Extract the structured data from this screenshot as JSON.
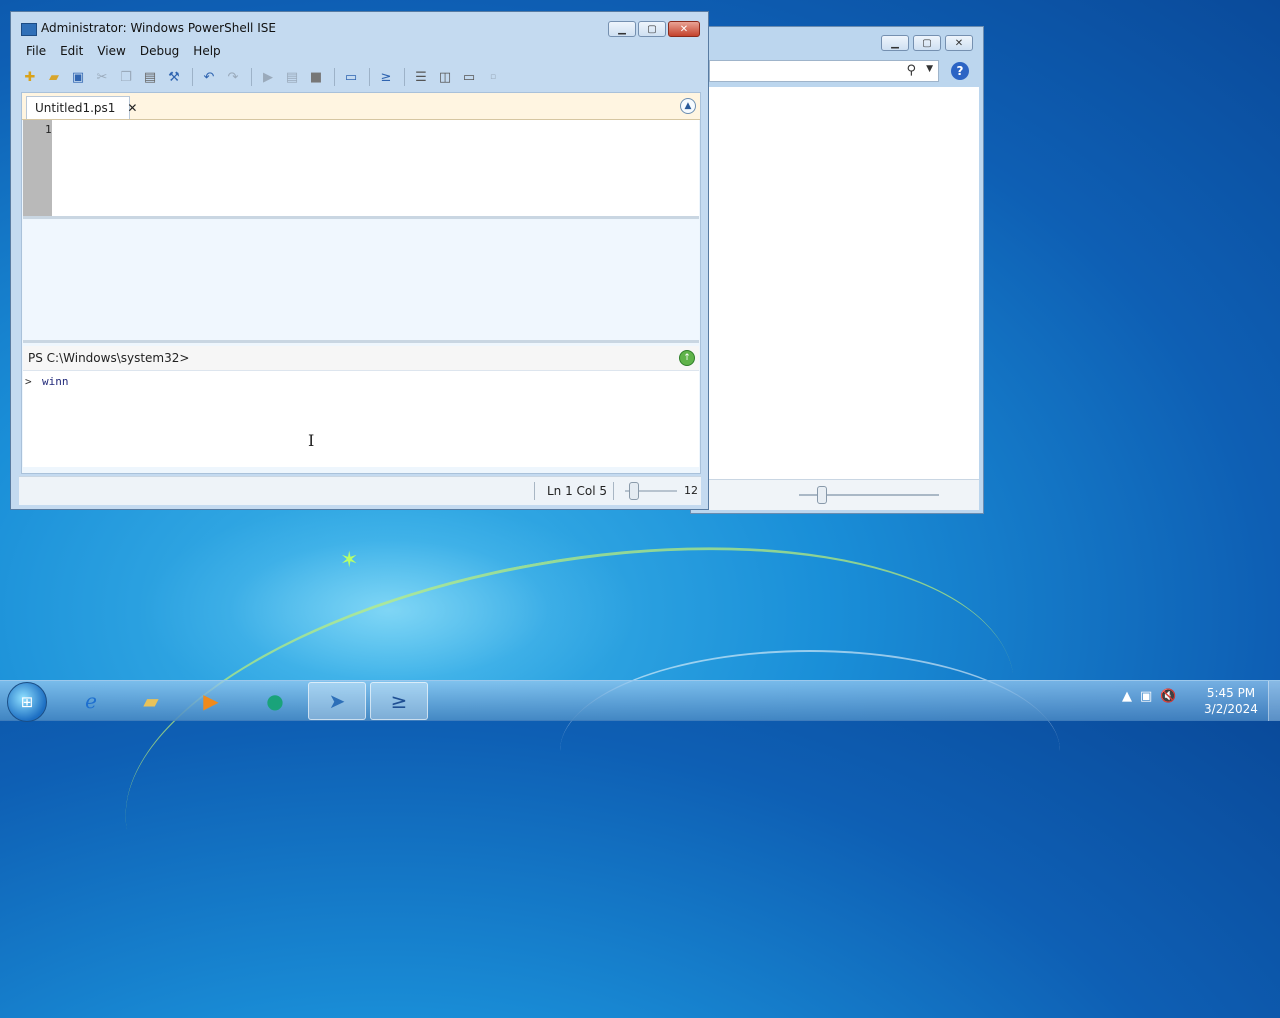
{
  "ise": {
    "title": "Administrator: Windows PowerShell ISE",
    "menu": [
      "File",
      "Edit",
      "View",
      "Debug",
      "Help"
    ],
    "tab_label": "Untitled1.ps1",
    "line_number": "1",
    "prompt": "PS C:\\Windows\\system32>",
    "command_prompt_symbol": ">",
    "command_text": "winn",
    "status_position": "Ln 1  Col 5",
    "zoom_value": "12"
  },
  "taskbar": {
    "time": "5:45 PM",
    "date": "3/2/2024",
    "apps": [
      "internet-explorer",
      "windows-explorer",
      "media-player",
      "chat-app",
      "powershell-taskbar",
      "powershell-ise"
    ]
  },
  "colors": {
    "wallpaper_accent": "#1a8fd8",
    "window_frame": "#c4daf0",
    "close_red": "#c4422c"
  }
}
